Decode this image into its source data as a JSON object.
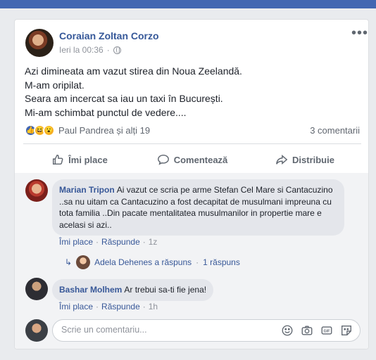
{
  "post": {
    "author": "Coraian Zoltan Corzo",
    "timestamp": "Ieri la 00:36",
    "text_lines": [
      "Azi dimineata am vazut stirea din Noua Zeelandă.",
      "M-am oripilat.",
      "Seara am incercat sa iau un taxi în București.",
      "Mi-am schimbat punctul de vedere...."
    ],
    "reactions_text": "Paul Pandrea și alți 19",
    "comments_count": "3 comentarii",
    "actions": {
      "like": "Îmi place",
      "comment": "Comentează",
      "share": "Distribuie"
    }
  },
  "comments": [
    {
      "author": "Marian Tripon",
      "text": "Ai vazut ce scria pe arme Stefan Cel Mare si Cantacuzino ..sa nu uitam ca Cantacuzino a fost decapitat de musulmani impreuna cu tota familia ..Din pacate mentalitatea musulmanilor in propertie mare e acelasi si azi..",
      "like_label": "Îmi place",
      "reply_label": "Răspunde",
      "age": "1z",
      "reply_summary": {
        "author_text": "Adela Dehenes a răspuns",
        "count_text": "1 răspuns"
      }
    },
    {
      "author": "Bashar Molhem",
      "text": "Ar trebui sa-ti fie jena!",
      "like_label": "Îmi place",
      "reply_label": "Răspunde",
      "age": "1h"
    }
  ],
  "comment_input": {
    "placeholder": "Scrie un comentariu..."
  },
  "icons": {
    "more": "more-options-icon",
    "globe": "globe-icon",
    "like": "thumbs-up-icon",
    "comment": "comment-bubble-icon",
    "share": "share-arrow-icon",
    "emoji": "emoji-icon",
    "camera": "camera-icon",
    "gif": "gif-icon",
    "sticker": "sticker-icon"
  },
  "colors": {
    "link": "#365899",
    "brand": "#4267b2",
    "muted": "#90949c"
  }
}
